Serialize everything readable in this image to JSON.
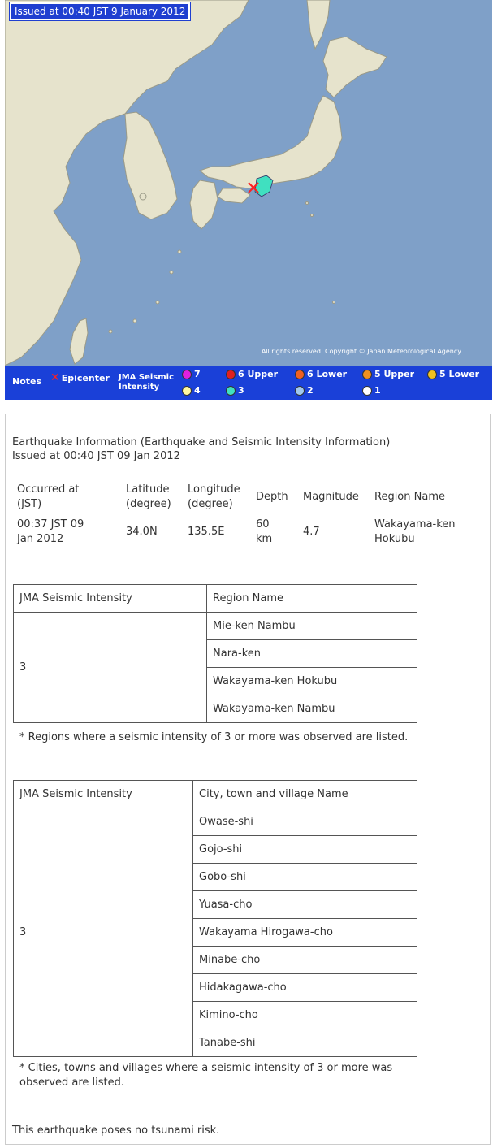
{
  "map": {
    "issued_label": "Issued at 00:40 JST  9 January 2012",
    "copyright": "All rights reserved. Copyright © Japan Meteorological Agency",
    "legend": {
      "notes": "Notes",
      "epicenter": "Epicenter",
      "jma_line1": "JMA Seismic",
      "jma_line2": "Intensity",
      "levels": [
        {
          "label": "7",
          "color": "#e020e0"
        },
        {
          "label": "6 Upper",
          "color": "#e02020"
        },
        {
          "label": "6 Lower",
          "color": "#f06020"
        },
        {
          "label": "5 Upper",
          "color": "#f09020"
        },
        {
          "label": "5 Lower",
          "color": "#f0c020"
        },
        {
          "label": "4",
          "color": "#fff8a0"
        },
        {
          "label": "3",
          "color": "#40e0c0"
        },
        {
          "label": "2",
          "color": "#a0c8f0"
        },
        {
          "label": "1",
          "color": "#ffffff"
        }
      ]
    }
  },
  "info": {
    "title": "Earthquake Information (Earthquake and Seismic Intensity Information)",
    "issued": "Issued at 00:40 JST 09 Jan 2012",
    "headers": {
      "occurred_1": "Occurred at",
      "occurred_2": "(JST)",
      "latitude_1": "Latitude",
      "latitude_2": "(degree)",
      "longitude_1": "Longitude",
      "longitude_2": "(degree)",
      "depth": "Depth",
      "magnitude": "Magnitude",
      "region": "Region Name"
    },
    "values": {
      "occurred_1": "00:37 JST 09",
      "occurred_2": "Jan 2012",
      "latitude": "34.0N",
      "longitude": "135.5E",
      "depth_1": "60",
      "depth_2": "km",
      "magnitude": "4.7",
      "region_1": "Wakayama-ken",
      "region_2": "Hokubu"
    }
  },
  "region_table": {
    "col1": "JMA Seismic Intensity",
    "col2": "Region Name",
    "intensity": "3",
    "rows": [
      "Mie-ken Nambu",
      "Nara-ken",
      "Wakayama-ken Hokubu",
      "Wakayama-ken Nambu"
    ],
    "note": "* Regions where a seismic intensity of 3 or more was observed are listed."
  },
  "city_table": {
    "col1": "JMA Seismic Intensity",
    "col2": "City, town and village Name",
    "intensity": "3",
    "rows": [
      "Owase-shi",
      "Gojo-shi",
      "Gobo-shi",
      "Yuasa-cho",
      "Wakayama Hirogawa-cho",
      "Minabe-cho",
      "Hidakagawa-cho",
      "Kimino-cho",
      "Tanabe-shi"
    ],
    "note_1": "* Cities, towns and villages where a seismic intensity of 3 or more was",
    "note_2": "observed are listed."
  },
  "tsunami": "This earthquake poses no tsunami risk."
}
